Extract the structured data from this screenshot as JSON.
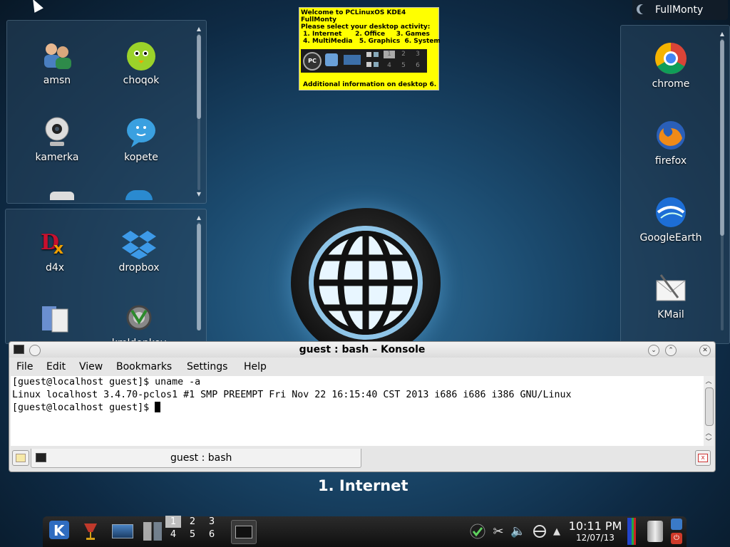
{
  "folder_views": {
    "top": {
      "icons": [
        "amsn",
        "choqok",
        "kamerka",
        "kopete"
      ]
    },
    "bottom": {
      "icons": [
        "d4x",
        "dropbox",
        "gftp",
        "kmldonkey"
      ]
    },
    "right": {
      "icons": [
        "chrome",
        "firefox",
        "GoogleEarth",
        "KMail"
      ]
    }
  },
  "note": {
    "line1": "Welcome to PCLinuxOS KDE4 FullMonty",
    "line2": "Please select your desktop activity:",
    "line3": " 1. Internet      2. Office     3. Games",
    "line4": " 4. MultiMedia   5. Graphics  6. System",
    "footer": "Additional information on desktop 6.",
    "strip_nums": [
      "1",
      "2",
      "3",
      "4",
      "5",
      "6"
    ]
  },
  "activity_widget": {
    "label": "FullMonty"
  },
  "activity_name": "1. Internet",
  "konsole": {
    "title": "guest : bash – Konsole",
    "menu": [
      "File",
      "Edit",
      "View",
      "Bookmarks",
      "Settings",
      "Help"
    ],
    "lines": [
      "[guest@localhost guest]$ uname -a",
      "Linux localhost 3.4.70-pclos1 #1 SMP PREEMPT Fri Nov 22 16:15:40 CST 2013 i686 i686 i386 GNU/Linux",
      "[guest@localhost guest]$ "
    ],
    "tab_label": "guest : bash"
  },
  "panel": {
    "pager": [
      "1",
      "2",
      "3",
      "4",
      "5",
      "6"
    ],
    "time": "10:11 PM",
    "date": "12/07/13"
  }
}
